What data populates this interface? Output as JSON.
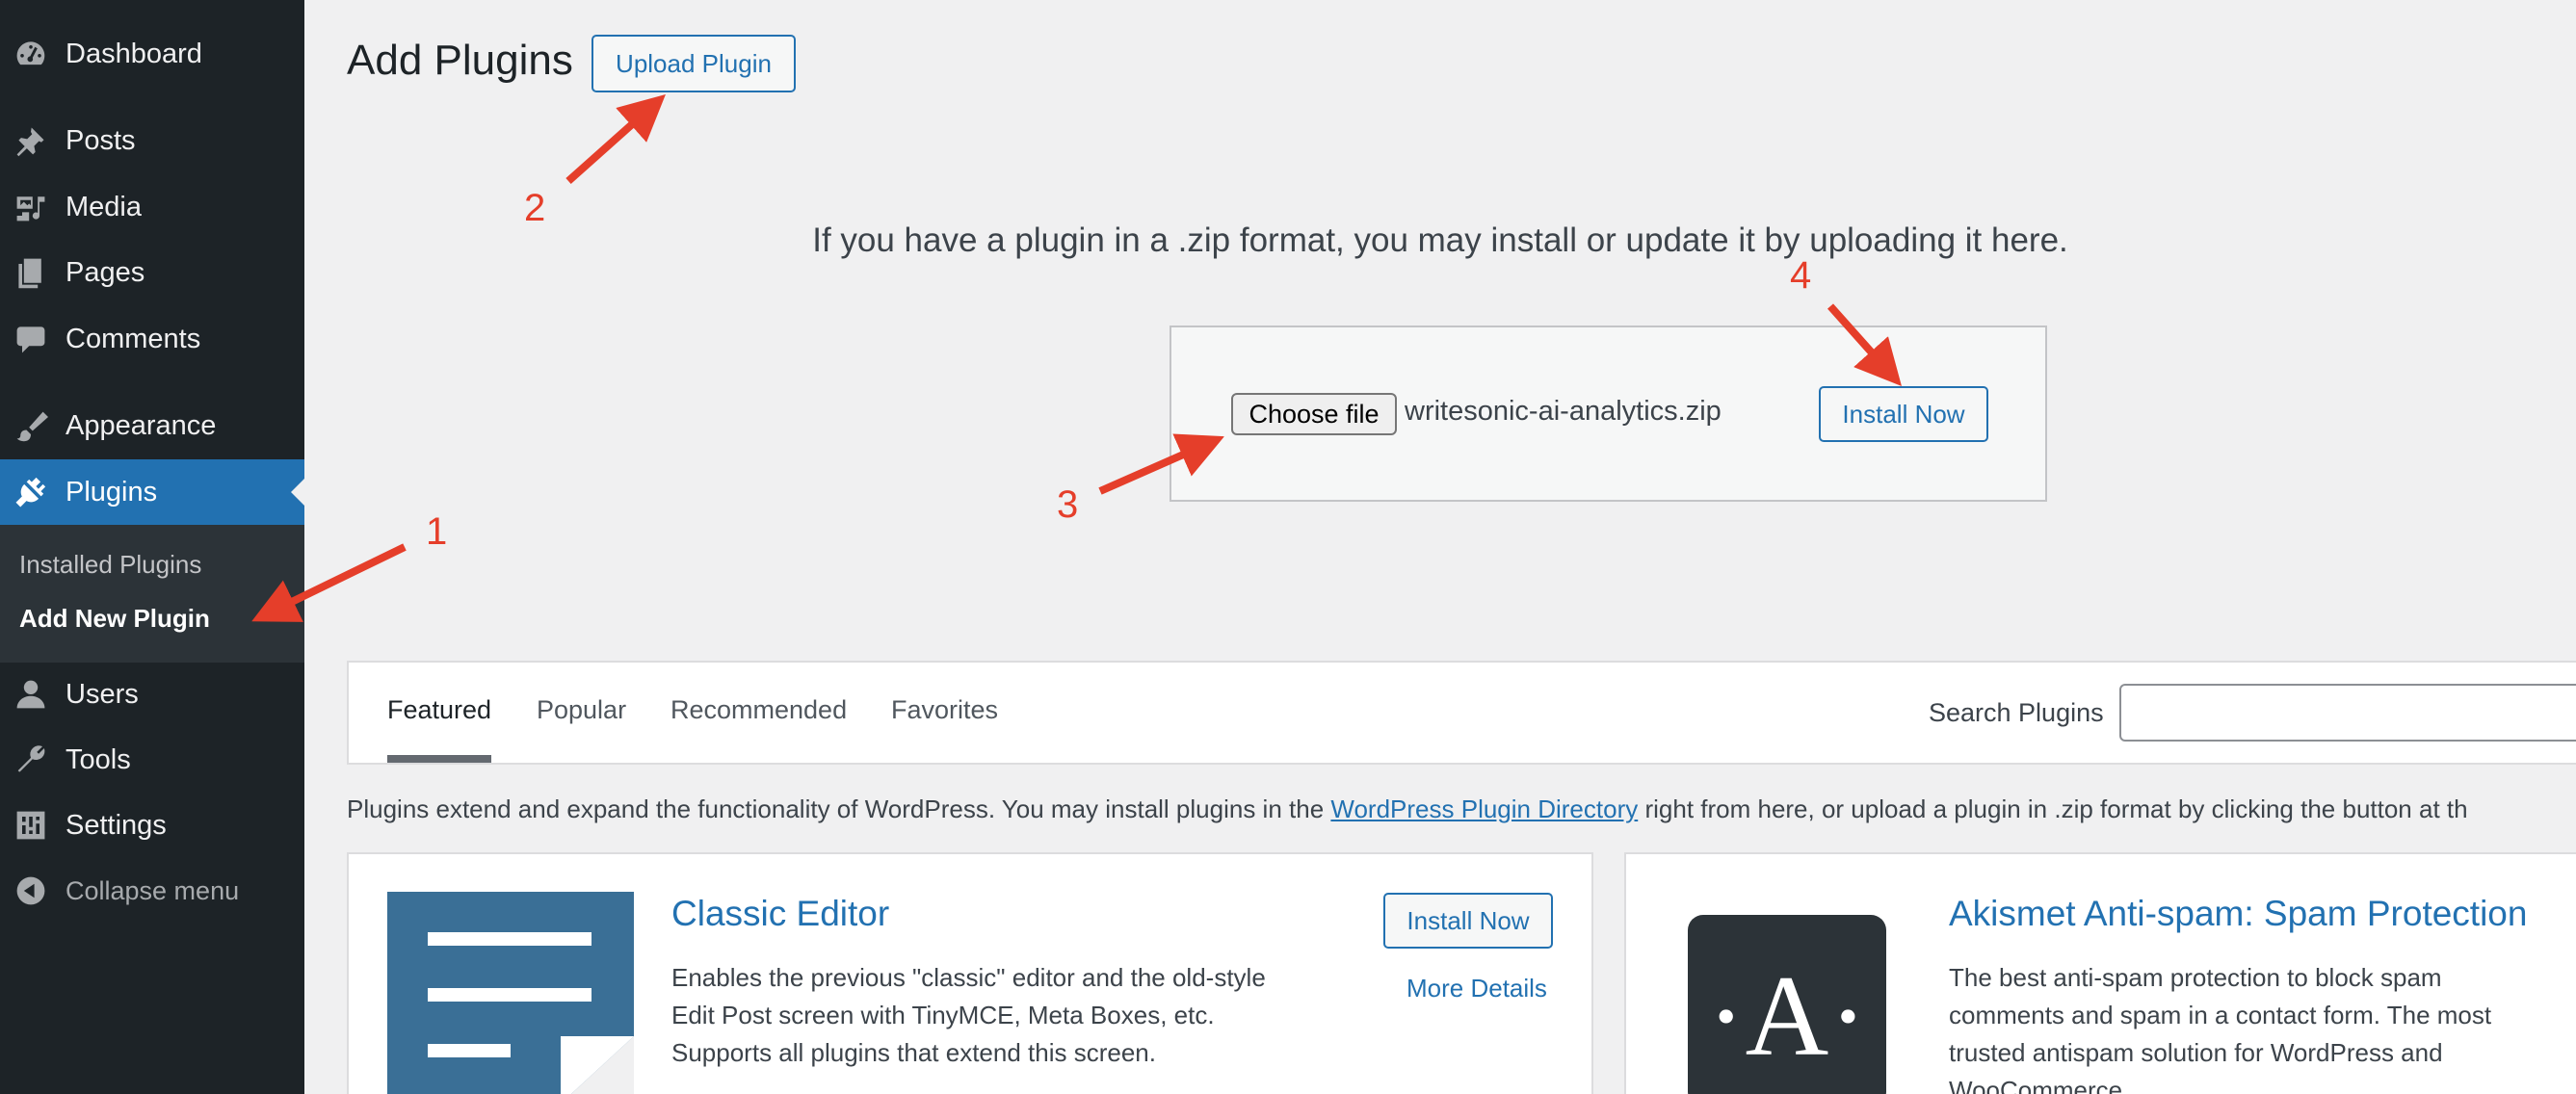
{
  "sidebar": {
    "items": [
      {
        "label": "Dashboard",
        "icon": "dashboard-icon"
      },
      {
        "label": "Posts",
        "icon": "pin-icon"
      },
      {
        "label": "Media",
        "icon": "media-icon"
      },
      {
        "label": "Pages",
        "icon": "pages-icon"
      },
      {
        "label": "Comments",
        "icon": "comment-icon"
      },
      {
        "label": "Appearance",
        "icon": "brush-icon"
      },
      {
        "label": "Plugins",
        "icon": "plug-icon"
      },
      {
        "label": "Users",
        "icon": "user-icon"
      },
      {
        "label": "Tools",
        "icon": "wrench-icon"
      },
      {
        "label": "Settings",
        "icon": "settings-icon"
      }
    ],
    "submenu": {
      "installed_plugins": "Installed Plugins",
      "add_new_plugin": "Add New Plugin"
    },
    "collapse_label": "Collapse menu"
  },
  "header": {
    "title": "Add Plugins",
    "upload_button": "Upload Plugin"
  },
  "upload": {
    "help_text": "If you have a plugin in a .zip format, you may install or update it by uploading it here.",
    "choose_file_label": "Choose file",
    "file_name": "writesonic-ai-analytics.zip",
    "install_button": "Install Now"
  },
  "tabs": [
    {
      "label": "Featured",
      "current": true
    },
    {
      "label": "Popular"
    },
    {
      "label": "Recommended"
    },
    {
      "label": "Favorites"
    }
  ],
  "search": {
    "label": "Search Plugins",
    "value": ""
  },
  "description": {
    "before_link": "Plugins extend and expand the functionality of WordPress. You may install plugins in the ",
    "link_text": "WordPress Plugin Directory",
    "after_link": " right from here, or upload a plugin in .zip format by clicking the button at th"
  },
  "cards": [
    {
      "title": "Classic Editor",
      "desc_lines": [
        "Enables the previous \"classic\" editor and the old-style",
        "Edit Post screen with TinyMCE, Meta Boxes, etc.",
        "Supports all plugins that extend this screen."
      ],
      "install_button": "Install Now",
      "more_details": "More Details"
    },
    {
      "title": "Akismet Anti-spam: Spam Protection",
      "icon_letter": "·A·",
      "desc_lines": [
        "The best anti-spam protection to block spam",
        "comments and spam in a contact form. The most",
        "trusted antispam solution for WordPress and",
        "WooCommerce."
      ]
    }
  ],
  "annotations": [
    "1",
    "2",
    "3",
    "4"
  ],
  "colors": {
    "sidebar_bg": "#1d2327",
    "accent": "#2271b1",
    "annotation": "#e53e2a"
  }
}
